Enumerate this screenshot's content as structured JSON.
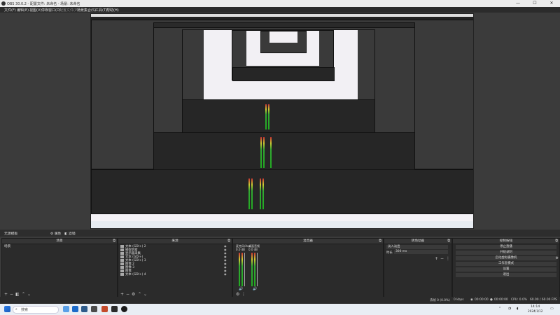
{
  "window": {
    "title": "OBS 30.0.2 - 配置文件: 未命名 - 场景: 未命名",
    "minimize": "—",
    "maximize": "☐",
    "close": "✕"
  },
  "menu": {
    "items": [
      "文件(F)",
      "编辑(E)",
      "视图(V)",
      "停靠窗口(D)",
      "配置文件(P)",
      "场景集合(S)",
      "工具(T)",
      "帮助(H)"
    ]
  },
  "scene_bar": {
    "label": "无源模板",
    "properties": "⚙ 属性",
    "filters": "◧ 滤镜"
  },
  "docks": {
    "scenes": {
      "title": "场景",
      "items": [
        "场景"
      ]
    },
    "sources": {
      "title": "来源",
      "items": [
        {
          "name": "文本 (GDI+) 2"
        },
        {
          "name": "捕捉后窗"
        },
        {
          "name": "显示器采集"
        },
        {
          "name": "文本 (GDI+)"
        },
        {
          "name": "文本 (GDI+) 3"
        },
        {
          "name": "图像 2"
        },
        {
          "name": "图像 3"
        },
        {
          "name": "图像"
        },
        {
          "name": "文本 (GDI+) 4"
        }
      ]
    },
    "mixer": {
      "title": "混音器",
      "ch1": "桌面音频",
      "ch2": "麦克风/Aux",
      "db1": "0.0 dB",
      "db2": "0.0 dB"
    },
    "transitions": {
      "title": "转场动画",
      "type": "淡入淡出",
      "duration_label": "时长",
      "duration_value": "300 ms"
    },
    "controls": {
      "title": "控制按钮",
      "buttons": [
        "停止直播",
        "开始录制",
        "启动虚拟摄像机",
        "工作室模式",
        "设置",
        "退出"
      ]
    }
  },
  "status": {
    "dropped": "丢帧 0 (0.0%)",
    "bitrate": "0 kbps",
    "live": "00:00:00",
    "rec": "00:00:00",
    "cpu": "CPU: 0.0%",
    "fps": "60.00 / 60.00 FPS"
  },
  "taskbar": {
    "search": "搜索",
    "time": "14:14",
    "date": "2024/1/12"
  }
}
